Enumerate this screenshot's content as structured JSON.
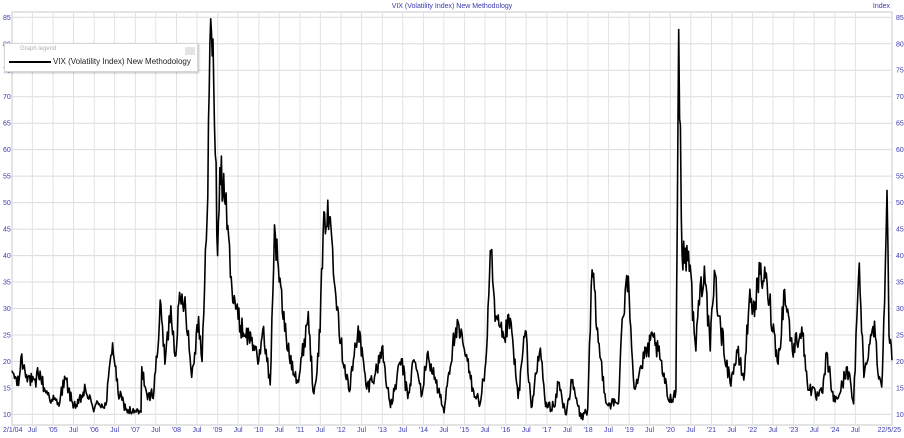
{
  "chart_data": {
    "type": "line",
    "title": "VIX (Volatility Index) New Methodology",
    "right_axis_label": "Index",
    "ylim": [
      8,
      86
    ],
    "y_ticks": [
      10,
      15,
      20,
      25,
      30,
      35,
      40,
      45,
      50,
      55,
      60,
      65,
      70,
      75,
      80,
      85
    ],
    "x_start_label": "2/1/04",
    "x_end_label": "22/5/25",
    "x_ticks": [
      {
        "label": "Jul",
        "date": "2004-07-01"
      },
      {
        "label": "'05",
        "date": "2005-01-01"
      },
      {
        "label": "Jul",
        "date": "2005-07-01"
      },
      {
        "label": "'06",
        "date": "2006-01-01"
      },
      {
        "label": "Jul",
        "date": "2006-07-01"
      },
      {
        "label": "'07",
        "date": "2007-01-01"
      },
      {
        "label": "Jul",
        "date": "2007-07-01"
      },
      {
        "label": "'08",
        "date": "2008-01-01"
      },
      {
        "label": "Jul",
        "date": "2008-07-01"
      },
      {
        "label": "'09",
        "date": "2009-01-01"
      },
      {
        "label": "Jul",
        "date": "2009-07-01"
      },
      {
        "label": "'10",
        "date": "2010-01-01"
      },
      {
        "label": "Jul",
        "date": "2010-07-01"
      },
      {
        "label": "'11",
        "date": "2011-01-01"
      },
      {
        "label": "Jul",
        "date": "2011-07-01"
      },
      {
        "label": "'12",
        "date": "2012-01-01"
      },
      {
        "label": "Jul",
        "date": "2012-07-01"
      },
      {
        "label": "'13",
        "date": "2013-01-01"
      },
      {
        "label": "Jul",
        "date": "2013-07-01"
      },
      {
        "label": "'14",
        "date": "2014-01-01"
      },
      {
        "label": "Jul",
        "date": "2014-07-01"
      },
      {
        "label": "'15",
        "date": "2015-01-01"
      },
      {
        "label": "Jul",
        "date": "2015-07-01"
      },
      {
        "label": "'16",
        "date": "2016-01-01"
      },
      {
        "label": "Jul",
        "date": "2016-07-01"
      },
      {
        "label": "'17",
        "date": "2017-01-01"
      },
      {
        "label": "Jul",
        "date": "2017-07-01"
      },
      {
        "label": "'18",
        "date": "2018-01-01"
      },
      {
        "label": "Jul",
        "date": "2018-07-01"
      },
      {
        "label": "'19",
        "date": "2019-01-01"
      },
      {
        "label": "Jul",
        "date": "2019-07-01"
      },
      {
        "label": "'20",
        "date": "2020-01-01"
      },
      {
        "label": "Jul",
        "date": "2020-07-01"
      },
      {
        "label": "'21",
        "date": "2021-01-01"
      },
      {
        "label": "Jul",
        "date": "2021-07-01"
      },
      {
        "label": "'22",
        "date": "2022-01-01"
      },
      {
        "label": "Jul",
        "date": "2022-07-01"
      },
      {
        "label": "'23",
        "date": "2023-01-01"
      },
      {
        "label": "Jul",
        "date": "2023-07-01"
      },
      {
        "label": "'24",
        "date": "2024-01-01"
      },
      {
        "label": "Jul",
        "date": "2024-07-01"
      }
    ],
    "grid": true,
    "legend": {
      "title": "Graph legend",
      "position": "top-left"
    },
    "series": [
      {
        "name": "VIX (Volatility Index) New Methodology",
        "color": "#000000",
        "points": [
          [
            "2004-01-02",
            18.2
          ],
          [
            "2004-03-01",
            15.5
          ],
          [
            "2004-03-22",
            20.8
          ],
          [
            "2004-05-10",
            17.5
          ],
          [
            "2004-08-01",
            15.2
          ],
          [
            "2004-08-16",
            18.8
          ],
          [
            "2004-10-15",
            15.0
          ],
          [
            "2004-12-20",
            12.8
          ],
          [
            "2005-02-15",
            12.2
          ],
          [
            "2005-04-20",
            16.8
          ],
          [
            "2005-06-15",
            12.5
          ],
          [
            "2005-08-01",
            11.5
          ],
          [
            "2005-10-15",
            14.8
          ],
          [
            "2005-12-20",
            11.2
          ],
          [
            "2006-02-15",
            12.0
          ],
          [
            "2006-04-15",
            11.8
          ],
          [
            "2006-06-13",
            23.5
          ],
          [
            "2006-08-01",
            14.0
          ],
          [
            "2006-10-15",
            11.0
          ],
          [
            "2006-12-20",
            10.3
          ],
          [
            "2007-02-20",
            10.4
          ],
          [
            "2007-02-27",
            19.0
          ],
          [
            "2007-04-20",
            12.8
          ],
          [
            "2007-06-15",
            14.5
          ],
          [
            "2007-08-16",
            30.8
          ],
          [
            "2007-09-20",
            19.5
          ],
          [
            "2007-11-12",
            30.5
          ],
          [
            "2007-12-20",
            21.0
          ],
          [
            "2008-01-22",
            31.0
          ],
          [
            "2008-03-17",
            32.2
          ],
          [
            "2008-05-15",
            17.0
          ],
          [
            "2008-07-15",
            28.5
          ],
          [
            "2008-08-15",
            20.0
          ],
          [
            "2008-09-29",
            47.0
          ],
          [
            "2008-10-24",
            80.0
          ],
          [
            "2008-11-20",
            80.9
          ],
          [
            "2008-12-31",
            40.0
          ],
          [
            "2009-01-20",
            56.6
          ],
          [
            "2009-03-09",
            49.7
          ],
          [
            "2009-05-01",
            36.0
          ],
          [
            "2009-07-01",
            28.0
          ],
          [
            "2009-09-01",
            25.0
          ],
          [
            "2009-11-01",
            24.5
          ],
          [
            "2009-12-24",
            19.5
          ],
          [
            "2010-02-05",
            26.0
          ],
          [
            "2010-04-12",
            15.6
          ],
          [
            "2010-05-20",
            45.8
          ],
          [
            "2010-07-01",
            35.0
          ],
          [
            "2010-09-15",
            22.0
          ],
          [
            "2010-12-20",
            16.2
          ],
          [
            "2011-03-16",
            29.4
          ],
          [
            "2011-04-28",
            14.3
          ],
          [
            "2011-06-15",
            21.0
          ],
          [
            "2011-08-08",
            48.0
          ],
          [
            "2011-10-03",
            45.5
          ],
          [
            "2011-12-30",
            23.4
          ],
          [
            "2012-03-15",
            14.3
          ],
          [
            "2012-06-01",
            26.7
          ],
          [
            "2012-08-15",
            14.8
          ],
          [
            "2012-11-15",
            18.5
          ],
          [
            "2012-12-28",
            22.7
          ],
          [
            "2013-03-15",
            11.3
          ],
          [
            "2013-06-20",
            20.5
          ],
          [
            "2013-08-15",
            13.0
          ],
          [
            "2013-10-08",
            20.3
          ],
          [
            "2013-12-20",
            13.8
          ],
          [
            "2014-02-03",
            21.4
          ],
          [
            "2014-04-14",
            17.0
          ],
          [
            "2014-07-03",
            10.3
          ],
          [
            "2014-08-07",
            17.0
          ],
          [
            "2014-10-15",
            26.3
          ],
          [
            "2014-12-16",
            23.6
          ],
          [
            "2015-03-15",
            15.0
          ],
          [
            "2015-05-20",
            12.1
          ],
          [
            "2015-07-08",
            19.7
          ],
          [
            "2015-08-24",
            40.7
          ],
          [
            "2015-09-29",
            27.6
          ],
          [
            "2015-12-14",
            24.4
          ],
          [
            "2016-02-11",
            28.1
          ],
          [
            "2016-04-20",
            13.0
          ],
          [
            "2016-06-24",
            25.8
          ],
          [
            "2016-08-15",
            11.3
          ],
          [
            "2016-11-04",
            22.5
          ],
          [
            "2016-12-20",
            11.5
          ],
          [
            "2017-03-15",
            11.6
          ],
          [
            "2017-04-13",
            16.0
          ],
          [
            "2017-06-15",
            10.0
          ],
          [
            "2017-08-11",
            16.0
          ],
          [
            "2017-11-01",
            9.2
          ],
          [
            "2017-12-29",
            11.0
          ],
          [
            "2018-02-06",
            37.3
          ],
          [
            "2018-04-02",
            23.6
          ],
          [
            "2018-06-15",
            12.0
          ],
          [
            "2018-09-28",
            12.1
          ],
          [
            "2018-10-24",
            25.2
          ],
          [
            "2018-12-24",
            36.1
          ],
          [
            "2019-02-15",
            14.9
          ],
          [
            "2019-05-14",
            20.6
          ],
          [
            "2019-08-05",
            24.6
          ],
          [
            "2019-10-01",
            20.5
          ],
          [
            "2019-12-20",
            12.5
          ],
          [
            "2020-02-20",
            14.4
          ],
          [
            "2020-03-16",
            82.7
          ],
          [
            "2020-04-15",
            40.0
          ],
          [
            "2020-06-11",
            40.8
          ],
          [
            "2020-08-15",
            22.0
          ],
          [
            "2020-09-08",
            31.5
          ],
          [
            "2020-10-30",
            38.0
          ],
          [
            "2020-12-20",
            22.0
          ],
          [
            "2021-01-27",
            37.2
          ],
          [
            "2021-03-04",
            28.6
          ],
          [
            "2021-06-15",
            16.0
          ],
          [
            "2021-08-20",
            21.7
          ],
          [
            "2021-10-15",
            16.5
          ],
          [
            "2021-12-01",
            31.1
          ],
          [
            "2022-01-24",
            31.2
          ],
          [
            "2022-03-07",
            36.5
          ],
          [
            "2022-05-09",
            34.8
          ],
          [
            "2022-08-15",
            19.5
          ],
          [
            "2022-10-12",
            33.6
          ],
          [
            "2022-12-20",
            22.0
          ],
          [
            "2023-03-13",
            26.5
          ],
          [
            "2023-05-01",
            16.0
          ],
          [
            "2023-07-15",
            13.3
          ],
          [
            "2023-09-15",
            14.0
          ],
          [
            "2023-10-20",
            21.7
          ],
          [
            "2023-12-20",
            12.5
          ],
          [
            "2024-02-15",
            14.0
          ],
          [
            "2024-04-19",
            19.0
          ],
          [
            "2024-06-15",
            12.0
          ],
          [
            "2024-08-05",
            38.6
          ],
          [
            "2024-09-15",
            17.0
          ],
          [
            "2024-10-31",
            23.2
          ],
          [
            "2024-12-18",
            27.6
          ],
          [
            "2025-01-10",
            19.5
          ],
          [
            "2025-02-20",
            15.2
          ],
          [
            "2025-03-10",
            27.9
          ],
          [
            "2025-04-08",
            52.3
          ],
          [
            "2025-04-25",
            24.8
          ],
          [
            "2025-05-22",
            20.3
          ]
        ]
      }
    ]
  }
}
